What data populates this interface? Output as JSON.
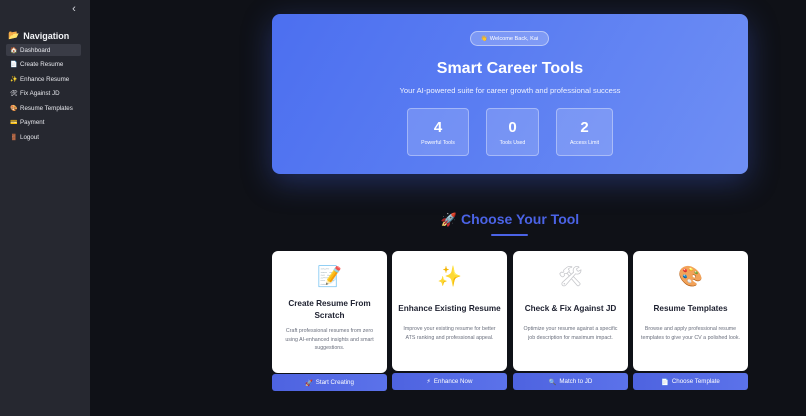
{
  "sidebar": {
    "collapse_icon": "chevron-left-icon",
    "title": "Navigation",
    "title_icon": "📂",
    "items": [
      {
        "label": "Dashboard",
        "icon": "🏠",
        "active": true
      },
      {
        "label": "Create Resume",
        "icon": "📄",
        "active": false
      },
      {
        "label": "Enhance Resume",
        "icon": "✨",
        "active": false
      },
      {
        "label": "Fix Against JD",
        "icon": "🛠",
        "active": false
      },
      {
        "label": "Resume Templates",
        "icon": "🎨",
        "active": false
      },
      {
        "label": "Payment",
        "icon": "💳",
        "active": false
      },
      {
        "label": "Logout",
        "icon": "🚪",
        "active": false
      }
    ]
  },
  "hero": {
    "welcome_icon": "👋",
    "welcome": "Welcome Back, Kai",
    "title": "Smart Career Tools",
    "subtitle": "Your AI-powered suite for career growth and professional success",
    "stats": [
      {
        "value": "4",
        "label": "Powerful Tools"
      },
      {
        "value": "0",
        "label": "Tools Used"
      },
      {
        "value": "2",
        "label": "Access Limit"
      }
    ]
  },
  "section": {
    "icon": "🚀",
    "title": "Choose Your Tool"
  },
  "cards": [
    {
      "icon": "📝",
      "title": "Create Resume From Scratch",
      "description": "Craft professional resumes from zero using AI-enhanced insights and smart suggestions.",
      "button_icon": "🚀",
      "button": "Start Creating"
    },
    {
      "icon": "✨",
      "title": "Enhance Existing Resume",
      "description": "Improve your existing resume for better ATS ranking and professional appeal.",
      "button_icon": "⚡",
      "button": "Enhance Now"
    },
    {
      "icon": "🛠",
      "title": "Check & Fix Against JD",
      "description": "Optimize your resume against a specific job description for maximum impact.",
      "button_icon": "🔍",
      "button": "Match to JD"
    },
    {
      "icon": "🎨",
      "title": "Resume Templates",
      "description": "Browse and apply professional resume templates to give your CV a polished look.",
      "button_icon": "📄",
      "button": "Choose Template"
    }
  ],
  "colors": {
    "background": "#0f1117",
    "sidebar": "#262830",
    "hero_gradient_start": "#4c6ff0",
    "accent": "#4b63e6",
    "card": "#ffffff"
  }
}
